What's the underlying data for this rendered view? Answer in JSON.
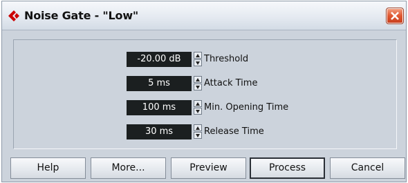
{
  "window": {
    "title": "Noise Gate - \"Low\"",
    "close_label": "×",
    "icons": {
      "app": "cubase-logo-icon",
      "close": "close-icon"
    },
    "colors": {
      "accent": "#cc0000",
      "panel": "#ccd3dc",
      "field": "#1b1f20"
    }
  },
  "params": [
    {
      "value": "-20.00 dB",
      "label": "Threshold"
    },
    {
      "value": "5 ms",
      "label": "Attack Time"
    },
    {
      "value": "100 ms",
      "label": "Min. Opening Time"
    },
    {
      "value": "30 ms",
      "label": "Release Time"
    }
  ],
  "buttons": {
    "help": "Help",
    "more": "More...",
    "preview": "Preview",
    "process": "Process",
    "cancel": "Cancel"
  }
}
